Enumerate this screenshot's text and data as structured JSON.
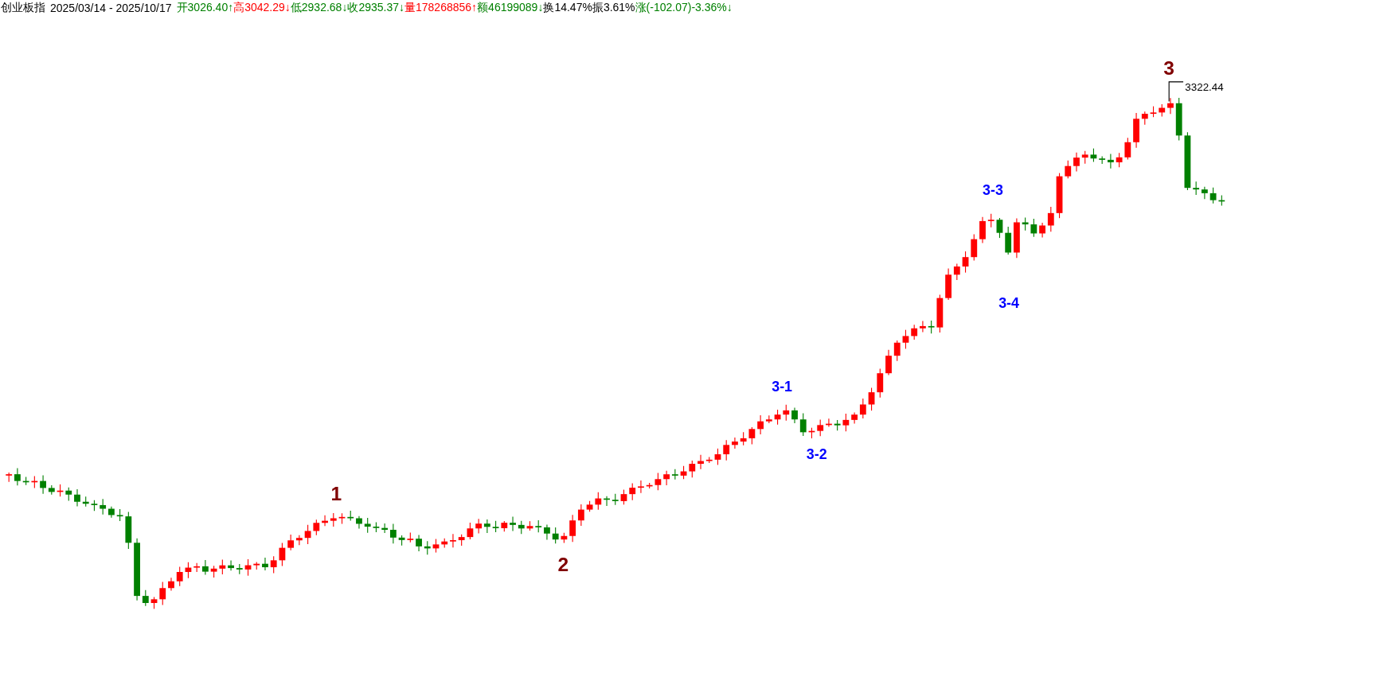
{
  "header": {
    "title": "创业板指",
    "range": "2025/03/14 - 2025/10/17",
    "quotes": [
      {
        "text": "开3026.40↑",
        "color": "#008000"
      },
      {
        "text": "高3042.29↓",
        "color": "#ff0000"
      },
      {
        "text": "低2932.68↓",
        "color": "#008000"
      },
      {
        "text": "收2935.37↓",
        "color": "#008000"
      },
      {
        "text": "量178268856↑",
        "color": "#ff0000"
      },
      {
        "text": "额46199089↓",
        "color": "#008000"
      },
      {
        "text": "换14.47%",
        "color": "#000000"
      },
      {
        "text": "振3.61%",
        "color": "#000000"
      },
      {
        "text": "涨(-102.07)-3.36%↓",
        "color": "#008000"
      }
    ]
  },
  "chart": {
    "annotations": [
      {
        "text": "1",
        "color": "#800000"
      },
      {
        "text": "2",
        "color": "#800000"
      },
      {
        "text": "3-1",
        "color": "#0000ff"
      },
      {
        "text": "3-2",
        "color": "#0000ff"
      },
      {
        "text": "3-3",
        "color": "#0000ff"
      },
      {
        "text": "3-4",
        "color": "#0000ff"
      },
      {
        "text": "3",
        "color": "#800000"
      }
    ],
    "max_label": "3322.44"
  }
}
